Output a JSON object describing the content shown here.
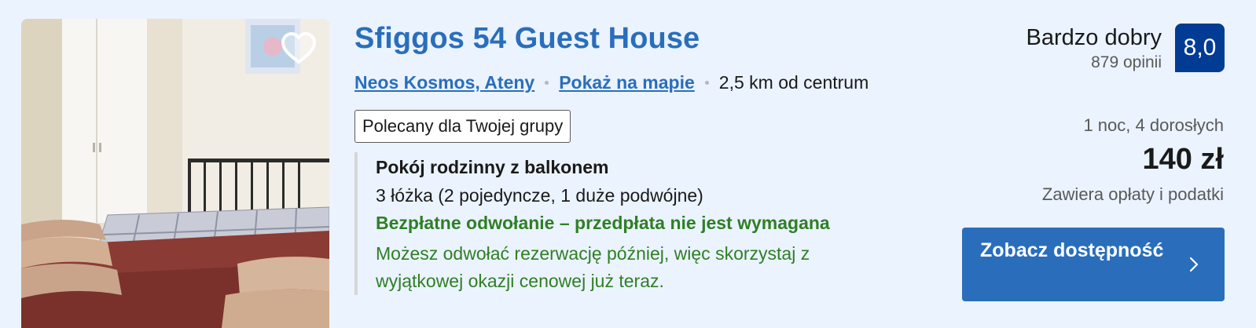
{
  "property": {
    "name": "Sfiggos 54 Guest House",
    "location_link": "Neos Kosmos, Ateny",
    "map_link": "Pokaż na mapie",
    "distance": "2,5 km od centrum",
    "badge": "Polecany dla Twojej grupy"
  },
  "room": {
    "name": "Pokój rodzinny z balkonem",
    "beds": "3 łóżka (2 pojedyncze, 1 duże podwójne)",
    "cancel_title": "Bezpłatne odwołanie – przedpłata nie jest wymagana",
    "cancel_text": "Możesz odwołać rezerwację później, więc skorzystaj z wyjątkowej okazji cenowej już teraz."
  },
  "rating": {
    "word": "Bardzo dobry",
    "reviews": "879 opinii",
    "score": "8,0"
  },
  "pricing": {
    "stay": "1 noc, 4 dorosłych",
    "price": "140 zł",
    "taxes": "Zawiera opłaty i podatki"
  },
  "cta": {
    "label": "Zobacz dostępność"
  },
  "colors": {
    "background": "#ebf3ff",
    "link_blue": "#2a6ebb",
    "score_navy": "#013b94",
    "green": "#2f7f24"
  },
  "icons": {
    "favorite": "heart-icon",
    "cta": "chevron-right-icon"
  }
}
